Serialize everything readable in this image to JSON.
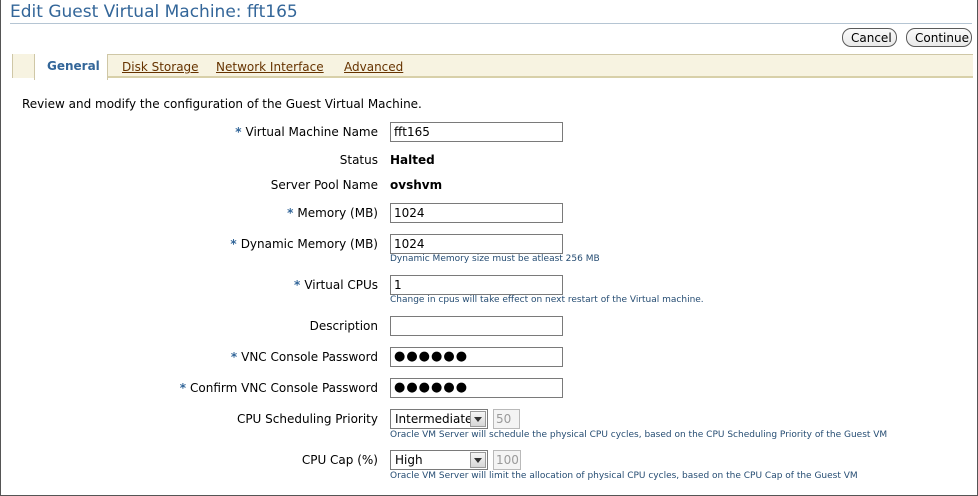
{
  "page": {
    "title": "Edit Guest Virtual Machine: fft165"
  },
  "actions": {
    "cancel_label": "Cancel",
    "continue_label": "Continue"
  },
  "tabs": [
    {
      "label": "General",
      "active": true
    },
    {
      "label": "Disk Storage",
      "active": false
    },
    {
      "label": "Network Interface",
      "active": false
    },
    {
      "label": "Advanced",
      "active": false
    }
  ],
  "intro": "Review and modify the configuration of the Guest Virtual Machine.",
  "required_marker": "*",
  "form": {
    "vm_name": {
      "label": "Virtual Machine Name",
      "value": "fft165"
    },
    "status": {
      "label": "Status",
      "value": "Halted"
    },
    "server_pool": {
      "label": "Server Pool Name",
      "value": "ovshvm"
    },
    "memory": {
      "label": "Memory (MB)",
      "value": "1024"
    },
    "dynamic_memory": {
      "label": "Dynamic Memory (MB)",
      "value": "1024",
      "hint": "Dynamic Memory size must be atleast 256 MB"
    },
    "vcpus": {
      "label": "Virtual CPUs",
      "value": "1",
      "hint": "Change in cpus will take effect on next restart of the Virtual machine."
    },
    "description": {
      "label": "Description",
      "value": ""
    },
    "vnc_password": {
      "label": "VNC Console Password",
      "value": "●●●●●●"
    },
    "confirm_vnc_password": {
      "label": "Confirm VNC Console Password",
      "value": "●●●●●●"
    },
    "cpu_priority": {
      "label": "CPU Scheduling Priority",
      "selected": "Intermediate",
      "number": "50",
      "hint": "Oracle VM Server will schedule the physical CPU cycles, based on the CPU Scheduling Priority of the Guest VM"
    },
    "cpu_cap": {
      "label": "CPU Cap (%)",
      "selected": "High",
      "number": "100",
      "hint": "Oracle VM Server will limit the allocation of physical CPU cycles, based on the CPU Cap of the Guest VM"
    }
  },
  "colors": {
    "title": "#336699",
    "tab_link": "#663300",
    "hint": "#264d73",
    "tabbar_bg": "#f7f3e1"
  }
}
